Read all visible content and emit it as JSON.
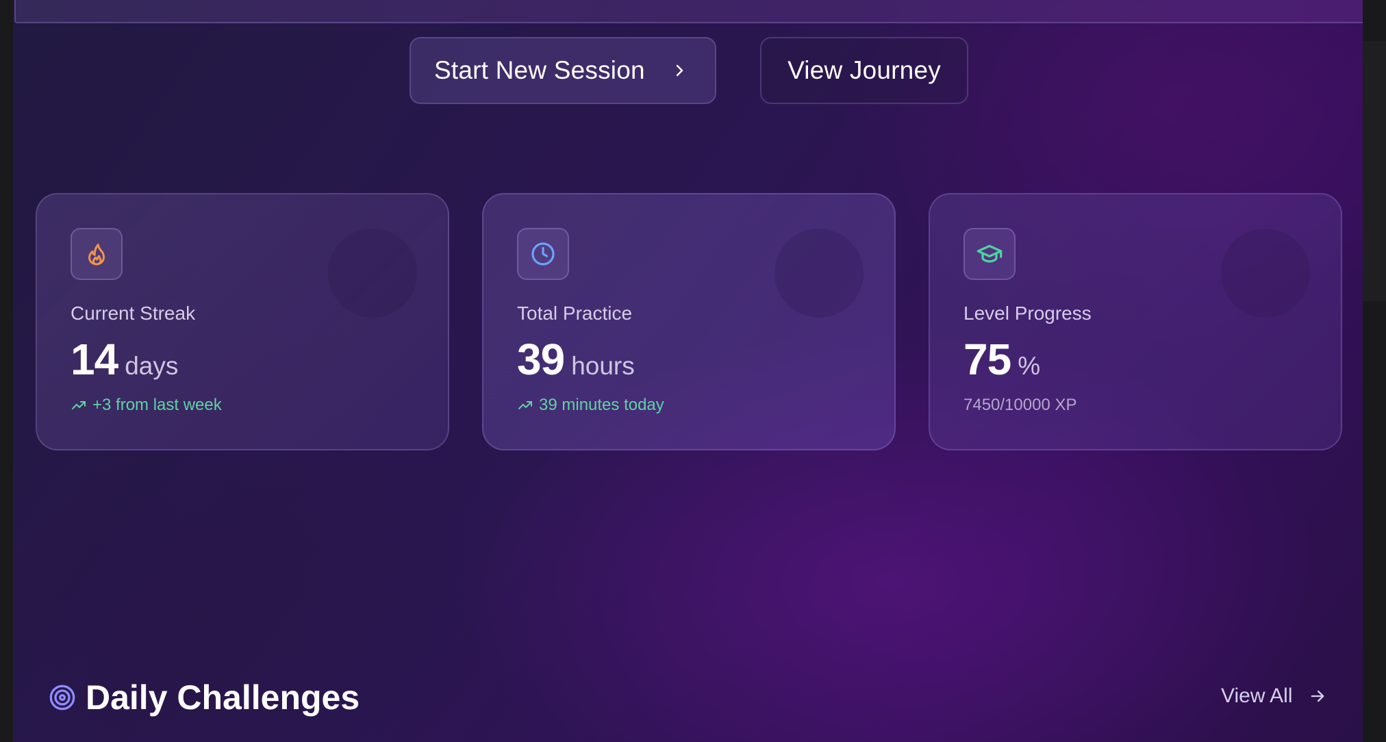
{
  "hero": {
    "primary_button": "Start New Session",
    "secondary_button": "View Journey"
  },
  "stats": [
    {
      "icon": "flame-icon",
      "icon_color": "#f2934b",
      "label": "Current Streak",
      "value": "14",
      "unit": "days",
      "sub": "+3 from last week",
      "sub_trend": "up"
    },
    {
      "icon": "clock-icon",
      "icon_color": "#6aa4ff",
      "label": "Total Practice",
      "value": "39",
      "unit": "hours",
      "sub": "39 minutes today",
      "sub_trend": "up"
    },
    {
      "icon": "graduation-cap-icon",
      "icon_color": "#4fd1a1",
      "label": "Level Progress",
      "value": "75",
      "unit": "%",
      "sub": "7450/10000 XP",
      "sub_trend": "none"
    }
  ],
  "challenges": {
    "title": "Daily Challenges",
    "view_all": "View All"
  },
  "colors": {
    "accent_green": "#5fd3a4",
    "target_icon": "#8f8cff"
  }
}
